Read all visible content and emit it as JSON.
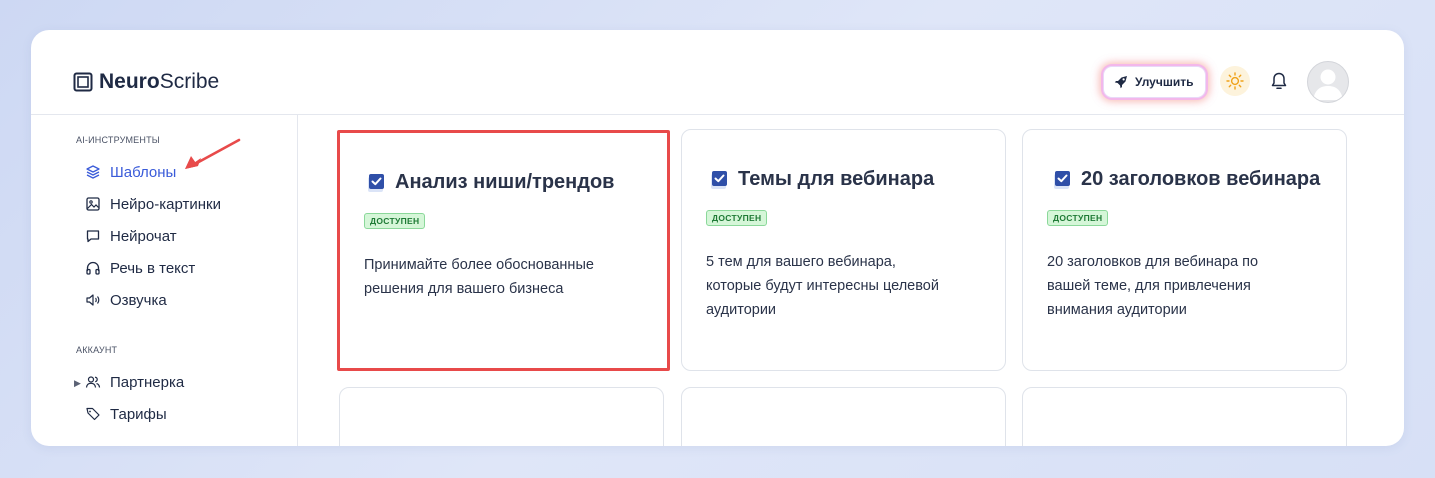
{
  "brand": {
    "bold": "Neuro",
    "light": "Scribe"
  },
  "header": {
    "upgrade_label": "Улучшить"
  },
  "sidebar": {
    "sections": [
      {
        "title": "AI-ИНСТРУМЕНТЫ",
        "items": [
          {
            "label": "Шаблоны",
            "icon": "layers-icon",
            "active": true
          },
          {
            "label": "Нейро-картинки",
            "icon": "image-icon"
          },
          {
            "label": "Нейрочат",
            "icon": "chat-icon"
          },
          {
            "label": "Речь в текст",
            "icon": "headphones-icon"
          },
          {
            "label": "Озвучка",
            "icon": "speaker-icon"
          }
        ]
      },
      {
        "title": "АККАУНТ",
        "items": [
          {
            "label": "Партнерка",
            "icon": "users-icon",
            "expandable": true
          },
          {
            "label": "Тарифы",
            "icon": "tag-icon"
          }
        ]
      }
    ]
  },
  "cards": [
    {
      "title": "Анализ ниши/трендов",
      "badge": "ДОСТУПЕН",
      "desc_lines": [
        "Принимайте более обоснованные",
        "решения для вашего бизнеса"
      ]
    },
    {
      "title": "Темы для вебинара",
      "badge": "ДОСТУПЕН",
      "desc_lines": [
        "5 тем для вашего вебинара,",
        "которые будут интересны целевой",
        "аудитории"
      ]
    },
    {
      "title": "20 заголовков вебинара",
      "badge": "ДОСТУПЕН",
      "desc_lines": [
        "20 заголовков для вебинара по",
        "вашей теме, для привлечения",
        "внимания аудитории"
      ]
    }
  ],
  "colors": {
    "accent": "#3a5bd9",
    "highlight": "#e84a4a",
    "badge_bg": "#d5f6d8"
  }
}
